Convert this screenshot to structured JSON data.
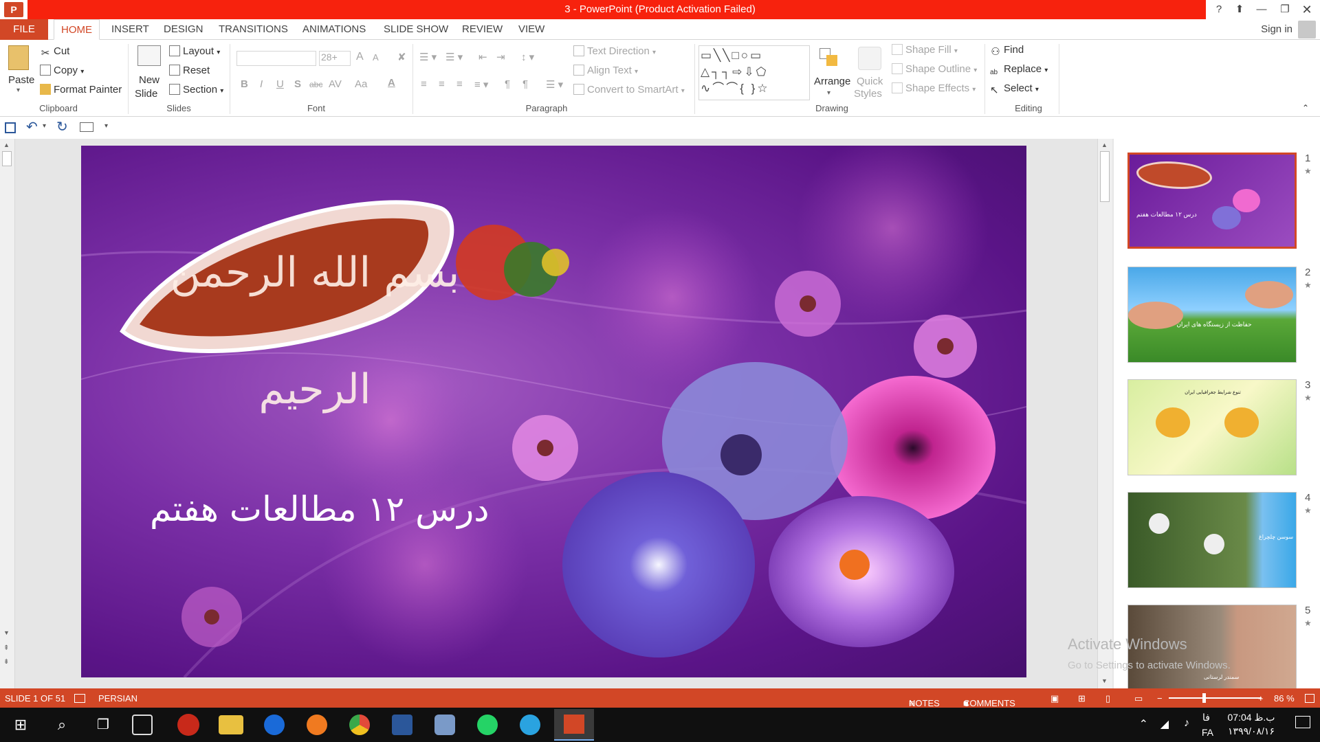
{
  "window": {
    "title": "3 -  PowerPoint (Product Activation Failed)",
    "app_icon": "P",
    "help": "?",
    "sign_in": "Sign in"
  },
  "tabs": [
    "FILE",
    "HOME",
    "INSERT",
    "DESIGN",
    "TRANSITIONS",
    "ANIMATIONS",
    "SLIDE SHOW",
    "REVIEW",
    "VIEW"
  ],
  "ribbon": {
    "clipboard": {
      "paste": "Paste",
      "cut": "Cut",
      "copy": "Copy",
      "format_painter": "Format Painter",
      "label": "Clipboard"
    },
    "slides": {
      "new_slide_1": "New",
      "new_slide_2": "Slide",
      "layout": "Layout",
      "reset": "Reset",
      "section": "Section",
      "label": "Slides"
    },
    "font": {
      "size": "28+",
      "grow": "A",
      "shrink": "A",
      "bold": "B",
      "italic": "I",
      "underline": "U",
      "shadow": "S",
      "strike": "abc",
      "spacing": "AV",
      "case": "Aa",
      "color": "A",
      "label": "Font"
    },
    "paragraph": {
      "text_direction": "Text Direction",
      "align_text": "Align Text",
      "convert_smartart": "Convert to SmartArt",
      "label": "Paragraph"
    },
    "drawing": {
      "arrange": "Arrange",
      "quick_styles_1": "Quick",
      "quick_styles_2": "Styles",
      "shape_fill": "Shape Fill",
      "shape_outline": "Shape Outline",
      "shape_effects": "Shape Effects",
      "label": "Drawing"
    },
    "editing": {
      "find": "Find",
      "replace": "Replace",
      "select": "Select",
      "label": "Editing"
    }
  },
  "slide": {
    "calligraphy": "بسم الله الرحمن الرحیم",
    "title": "درس ۱۲ مطالعات هفتم"
  },
  "thumbnails": [
    {
      "num": "1",
      "caption": "درس ۱۲ مطالعات هفتم"
    },
    {
      "num": "2",
      "caption": "حفاظت از زیستگاه های ایران"
    },
    {
      "num": "3",
      "caption": "تنوع شرایط جغرافیایی ایران"
    },
    {
      "num": "4",
      "caption": "سوسن چلچراغ"
    },
    {
      "num": "5",
      "caption": "سمندر لرستانی"
    }
  ],
  "watermark": {
    "line1": "Activate Windows",
    "line2": "Go to Settings to activate Windows."
  },
  "status": {
    "slide": "SLIDE 1 OF 51",
    "language": "PERSIAN",
    "notes": "NOTES",
    "comments": "COMMENTS",
    "zoom": "86 %"
  },
  "tray": {
    "time": "07:04 ب.ظ",
    "date": "۱۳۹۹/۰۸/۱۶",
    "lang1": "فا",
    "lang2": "FA"
  },
  "colors": {
    "accent": "#d24726",
    "title_bar": "#f7220d",
    "slide_bg": "#6b2298",
    "taskbar": "#101010"
  }
}
